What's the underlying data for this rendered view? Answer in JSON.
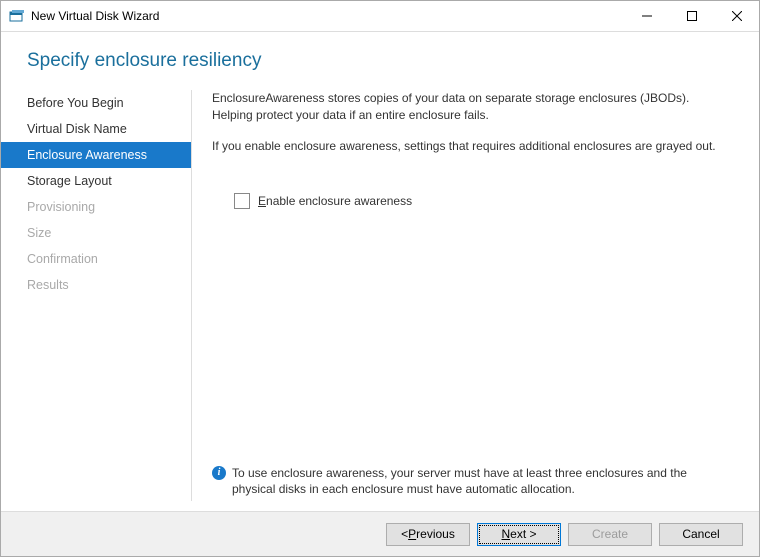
{
  "window": {
    "title": "New Virtual Disk Wizard"
  },
  "header": {
    "title": "Specify enclosure resiliency"
  },
  "nav": {
    "items": [
      {
        "label": "Before You Begin",
        "state": "enabled"
      },
      {
        "label": "Virtual Disk Name",
        "state": "enabled"
      },
      {
        "label": "Enclosure Awareness",
        "state": "selected"
      },
      {
        "label": "Storage Layout",
        "state": "enabled"
      },
      {
        "label": "Provisioning",
        "state": "disabled"
      },
      {
        "label": "Size",
        "state": "disabled"
      },
      {
        "label": "Confirmation",
        "state": "disabled"
      },
      {
        "label": "Results",
        "state": "disabled"
      }
    ]
  },
  "content": {
    "para1": "EnclosureAwareness stores copies of your data on separate storage enclosures (JBODs). Helping protect your data if an entire enclosure fails.",
    "para2": "If you enable enclosure awareness, settings that requires additional enclosures are grayed out.",
    "checkbox_prefix": "E",
    "checkbox_rest": "nable enclosure awareness",
    "checkbox_checked": false,
    "info_text": "To use enclosure awareness, your server must have at least three enclosures and the physical disks in each enclosure must have automatic allocation."
  },
  "footer": {
    "previous_prefix": "< ",
    "previous_ul": "P",
    "previous_rest": "revious",
    "next_ul": "N",
    "next_rest": "ext >",
    "create_label": "Create",
    "cancel_label": "Cancel"
  }
}
